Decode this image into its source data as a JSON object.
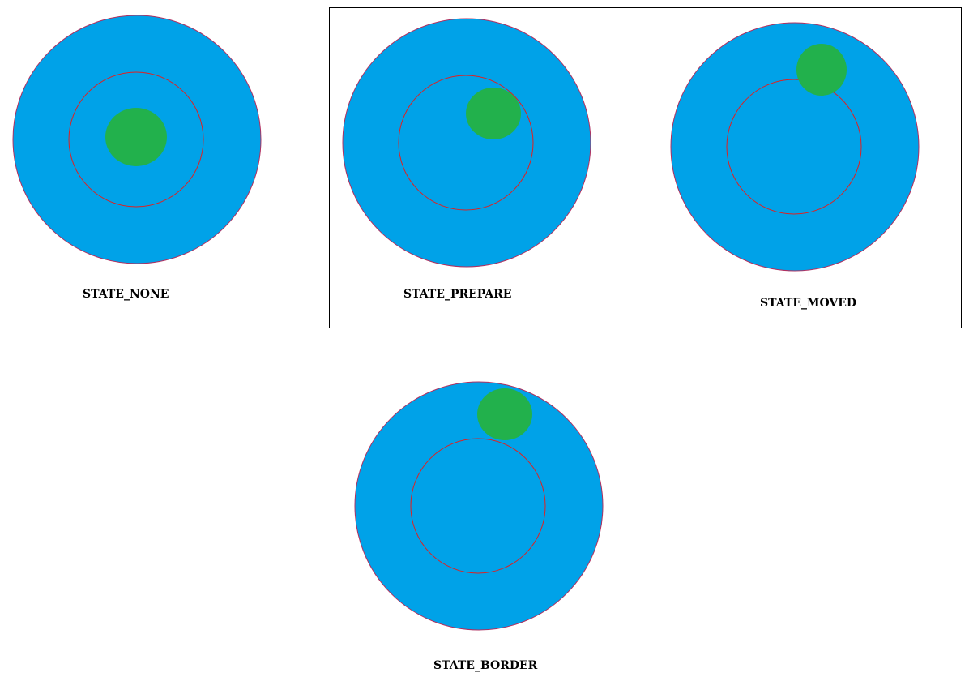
{
  "colors": {
    "outer_fill": "#00a2e8",
    "outer_stroke": "#b03060",
    "inner_ring": "#e02020",
    "knob": "#22b14c",
    "group_frame": "#000000"
  },
  "states": [
    {
      "id": "none",
      "label": "STATE_NONE",
      "knob_position": "center"
    },
    {
      "id": "prepare",
      "label": "STATE_PREPARE",
      "knob_position": "inside inner ring, near edge"
    },
    {
      "id": "moved",
      "label": "STATE_MOVED",
      "knob_position": "outside inner ring, within outer circle"
    },
    {
      "id": "border",
      "label": "STATE_BORDER",
      "knob_position": "at outer circle edge"
    }
  ]
}
